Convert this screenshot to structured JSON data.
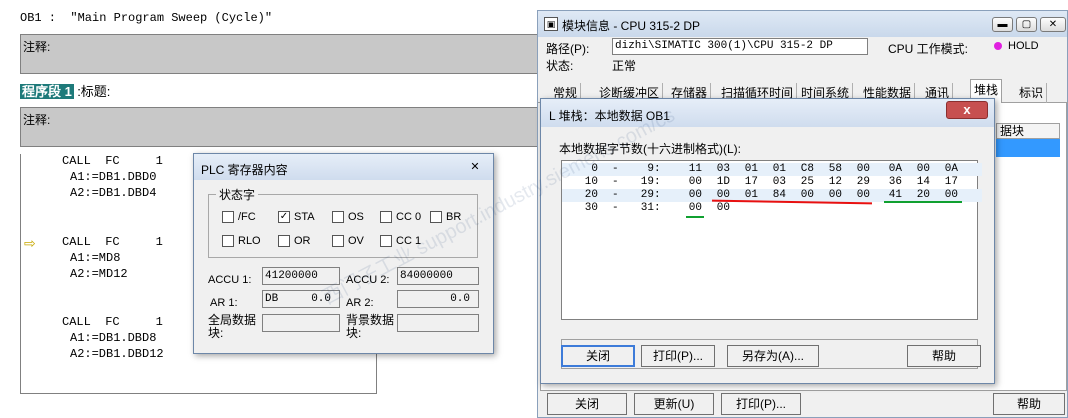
{
  "editor": {
    "header": "OB1 :  \"Main Program Sweep (Cycle)\"",
    "comment_label": "注释:",
    "network_label": "程序段 1",
    "network_title": ":标题:",
    "stl_lines": [
      "CALL  FC     1",
      "A1:=DB1.DBD0",
      "A2:=DB1.DBD4",
      "CALL  FC     1",
      "A1:=MD8",
      "A2:=MD12",
      "CALL  FC     1",
      "A1:=DB1.DBD8",
      "A2:=DB1.DBD12"
    ]
  },
  "plc": {
    "title": "PLC 寄存器内容",
    "status_group": "状态字",
    "bits_row1": [
      {
        "label": "/FC",
        "checked": false
      },
      {
        "label": "STA",
        "checked": true
      },
      {
        "label": "OS",
        "checked": false
      },
      {
        "label": "CC 0",
        "checked": false
      },
      {
        "label": "BR",
        "checked": false
      }
    ],
    "bits_row2": [
      {
        "label": "RLO",
        "checked": false
      },
      {
        "label": "OR",
        "checked": false
      },
      {
        "label": "OV",
        "checked": false
      },
      {
        "label": "CC 1",
        "checked": false
      }
    ],
    "accu1_label": "ACCU 1:",
    "accu1_value": "41200000",
    "accu2_label": "ACCU 2:",
    "accu2_value": "84000000",
    "ar1_label": "AR 1:",
    "ar1_prefix": "DB",
    "ar1_value": "0.0",
    "ar2_label": "AR 2:",
    "ar2_value": "0.0",
    "global_db_label": "全局数据块:",
    "instance_db_label": "背景数据块:"
  },
  "module": {
    "title": "模块信息 - CPU 315-2 DP",
    "path_label": "路径(P):",
    "path_value": "dizhi\\SIMATIC 300(1)\\CPU 315-2 DP",
    "mode_label": "CPU 工作模式:",
    "mode_value": "HOLD",
    "mode_color": "#e020e0",
    "state_label": "状态:",
    "state_value": "正常",
    "tabs": [
      "常规",
      "诊断缓冲区",
      "存储器",
      "扫描循环时间",
      "时间系统",
      "性能数据",
      "通讯",
      "堆栈",
      "标识"
    ],
    "bottom_buttons": [
      "关闭",
      "更新(U)",
      "打印(P)...",
      "帮助"
    ],
    "side_label": "据块"
  },
  "lstack": {
    "title": "L 堆栈：本地数据 OB1",
    "caption": "本地数据字节数(十六进制格式)(L):",
    "rows": [
      {
        "from": "0",
        "to": "9",
        "vals": [
          "11",
          "03",
          "01",
          "01",
          "C8",
          "58",
          "00",
          "0A",
          "00",
          "0A"
        ]
      },
      {
        "from": "10",
        "to": "19",
        "vals": [
          "00",
          "1D",
          "17",
          "03",
          "25",
          "12",
          "29",
          "36",
          "14",
          "17"
        ]
      },
      {
        "from": "20",
        "to": "29",
        "vals": [
          "00",
          "00",
          "01",
          "84",
          "00",
          "00",
          "00",
          "41",
          "20",
          "00"
        ]
      },
      {
        "from": "30",
        "to": "31",
        "vals": [
          "00",
          "00"
        ]
      }
    ],
    "buttons": [
      "关闭",
      "打印(P)...",
      "另存为(A)...",
      "帮助"
    ],
    "close_glyph": "x"
  },
  "watermark": "西门子工业 support.industry.siemens.com/cs"
}
